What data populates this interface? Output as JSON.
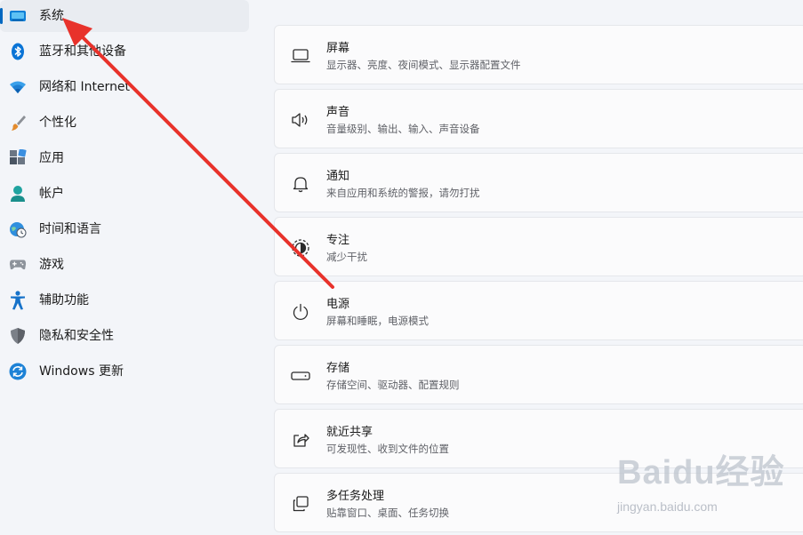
{
  "sidebar": {
    "items": [
      {
        "label": "系统",
        "icon": "monitor-system-icon",
        "selected": true
      },
      {
        "label": "蓝牙和其他设备",
        "icon": "bluetooth-icon"
      },
      {
        "label": "网络和 Internet",
        "icon": "wifi-icon"
      },
      {
        "label": "个性化",
        "icon": "brush-icon"
      },
      {
        "label": "应用",
        "icon": "apps-icon"
      },
      {
        "label": "帐户",
        "icon": "account-icon"
      },
      {
        "label": "时间和语言",
        "icon": "globe-clock-icon"
      },
      {
        "label": "游戏",
        "icon": "gamepad-icon"
      },
      {
        "label": "辅助功能",
        "icon": "accessibility-icon"
      },
      {
        "label": "隐私和安全性",
        "icon": "shield-icon"
      },
      {
        "label": "Windows 更新",
        "icon": "windows-update-icon"
      }
    ]
  },
  "settings": [
    {
      "title": "屏幕",
      "subtitle": "显示器、亮度、夜间模式、显示器配置文件",
      "icon": "display-icon"
    },
    {
      "title": "声音",
      "subtitle": "音量级别、输出、输入、声音设备",
      "icon": "speaker-icon"
    },
    {
      "title": "通知",
      "subtitle": "来自应用和系统的警报，请勿打扰",
      "icon": "bell-icon"
    },
    {
      "title": "专注",
      "subtitle": "减少干扰",
      "icon": "focus-icon"
    },
    {
      "title": "电源",
      "subtitle": "屏幕和睡眠，电源模式",
      "icon": "power-icon"
    },
    {
      "title": "存储",
      "subtitle": "存储空间、驱动器、配置规则",
      "icon": "storage-icon"
    },
    {
      "title": "就近共享",
      "subtitle": "可发现性、收到文件的位置",
      "icon": "share-icon"
    },
    {
      "title": "多任务处理",
      "subtitle": "贴靠窗口、桌面、任务切换",
      "icon": "multitasking-icon"
    }
  ],
  "watermark": {
    "logo": "Baidu经验",
    "url": "jingyan.baidu.com"
  },
  "colors": {
    "accent": "#0067c0",
    "annotation_arrow": "#e8322b"
  }
}
